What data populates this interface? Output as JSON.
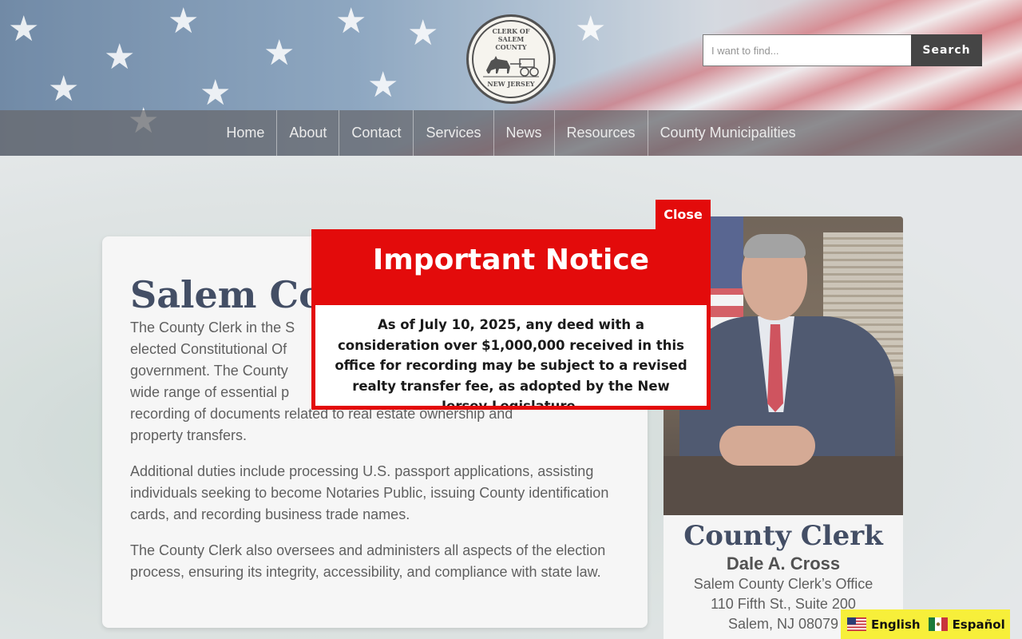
{
  "header": {
    "seal": {
      "top_text": "CLERK OF SALEM COUNTY",
      "bottom_text": "NEW JERSEY"
    },
    "search": {
      "placeholder": "I want to find...",
      "button_label": "Search"
    }
  },
  "nav": {
    "items": [
      {
        "label": "Home"
      },
      {
        "label": "About"
      },
      {
        "label": "Contact"
      },
      {
        "label": "Services"
      },
      {
        "label": "News"
      },
      {
        "label": "Resources"
      },
      {
        "label": "County Municipalities"
      }
    ]
  },
  "main": {
    "title": "Salem Cou",
    "paragraphs": [
      "The County Clerk in the S",
      "elected Constitutional Of",
      "government. The County",
      "wide range of essential p",
      "recording of documents related to real estate ownership and",
      "property transfers.",
      "Additional duties include processing U.S. passport applications, assisting individuals seeking to become Notaries Public, issuing County identification cards, and recording business trade names.",
      "The County Clerk also oversees and administers all aspects of the election process, ensuring its integrity, accessibility, and compliance with state law."
    ]
  },
  "clerk": {
    "title": "County Clerk",
    "name": "Dale A. Cross",
    "office": "Salem County Clerk’s Office",
    "address1": "110 Fifth St., Suite 200",
    "address2": "Salem, NJ 08079"
  },
  "modal": {
    "close_label": "Close",
    "title": "Important Notice",
    "body": "As of July 10, 2025, any deed with a consideration over $1,000,000 received in this office for recording may be subject to a revised realty transfer fee, as adopted by the New Jersey Legislature."
  },
  "language": {
    "english": "English",
    "spanish": "Español"
  },
  "colors": {
    "modal_red": "#e30b0b",
    "navy": "#0f1d3a",
    "lang_bar": "#f7ef3a"
  }
}
